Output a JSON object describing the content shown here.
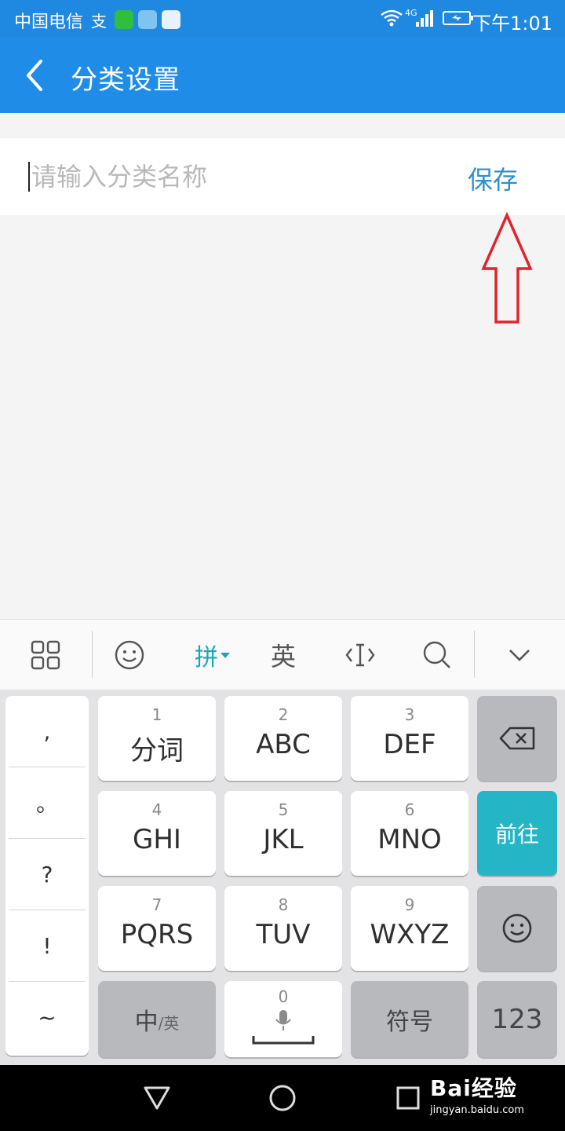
{
  "status_bar": {
    "carrier": "中国电信",
    "network": "4G",
    "time": "下午1:01"
  },
  "header": {
    "title": "分类设置",
    "back_icon": "chevron-left-icon"
  },
  "form": {
    "name_placeholder": "请输入分类名称",
    "name_value": "",
    "save_label": "保存"
  },
  "annotation": {
    "arrow_color": "#e0242b"
  },
  "keyboard": {
    "toolbar": {
      "pinyin_label": "拼",
      "english_label": "英"
    },
    "punctuation": [
      ",",
      "。",
      "?",
      "!",
      "~"
    ],
    "keys": [
      {
        "num": "1",
        "label": "分词"
      },
      {
        "num": "2",
        "label": "ABC"
      },
      {
        "num": "3",
        "label": "DEF"
      },
      {
        "num": "4",
        "label": "GHI"
      },
      {
        "num": "5",
        "label": "JKL"
      },
      {
        "num": "6",
        "label": "MNO"
      },
      {
        "num": "7",
        "label": "PQRS"
      },
      {
        "num": "8",
        "label": "TUV"
      },
      {
        "num": "9",
        "label": "WXYZ"
      }
    ],
    "go_label": "前往",
    "zh_label": "中",
    "en_small_label": "/英",
    "space_num": "0",
    "symbol_label": "符号",
    "num_mode_label": "123"
  },
  "watermark": {
    "main": "Bai经验",
    "sub": "jingyan.baidu.com"
  },
  "colors": {
    "header_blue": "#1f8ce8",
    "save_blue": "#2b8ed3",
    "teal_key": "#24b5c7",
    "pinyin_teal": "#1aa6b7"
  }
}
